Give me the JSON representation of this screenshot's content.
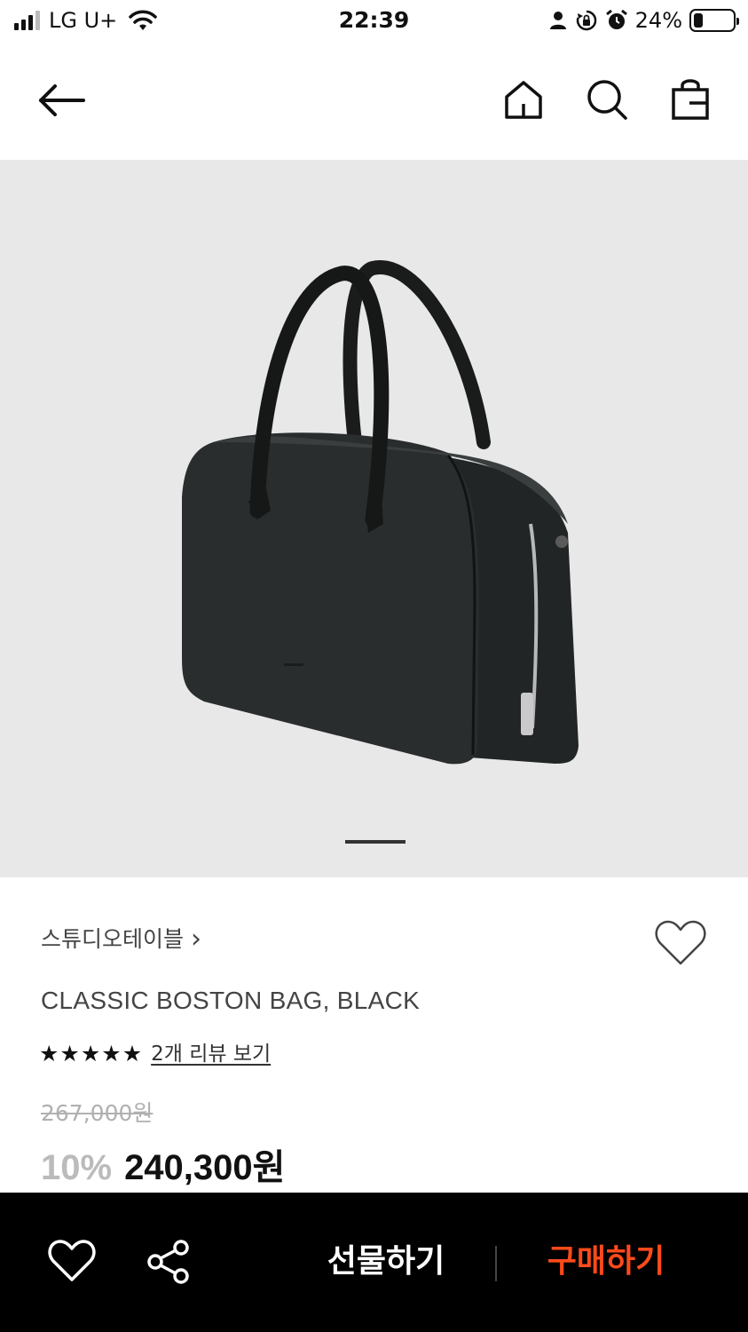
{
  "status_bar": {
    "carrier": "LG U+",
    "time": "22:39",
    "battery_percent": "24%",
    "battery_level": 0.24,
    "icons": [
      "signal-icon",
      "wifi-icon",
      "person-icon",
      "rotation-lock-icon",
      "alarm-icon",
      "battery-icon"
    ]
  },
  "header": {
    "icons": [
      "back-arrow-icon",
      "home-icon",
      "search-icon",
      "shopping-bag-icon"
    ]
  },
  "gallery": {
    "image": "black leather boston bag",
    "current_page": 1
  },
  "product": {
    "brand": "스튜디오테이블",
    "brand_chevron": "›",
    "name": "CLASSIC BOSTON BAG, BLACK",
    "rating": 5,
    "rating_max": 5,
    "review_link": "2개 리뷰 보기",
    "original_price": "267,000원",
    "discount": "10%",
    "sale_price": "240,300원"
  },
  "bottom_bar": {
    "gift_label": "선물하기",
    "buy_label": "구매하기",
    "icons": [
      "heart-icon",
      "share-icon"
    ]
  },
  "colors": {
    "buy_accent": "#ff4a1a",
    "image_bg": "#e8e8e8",
    "bottom_bar_bg": "#000000",
    "discount_gray": "#bbbbbb"
  }
}
